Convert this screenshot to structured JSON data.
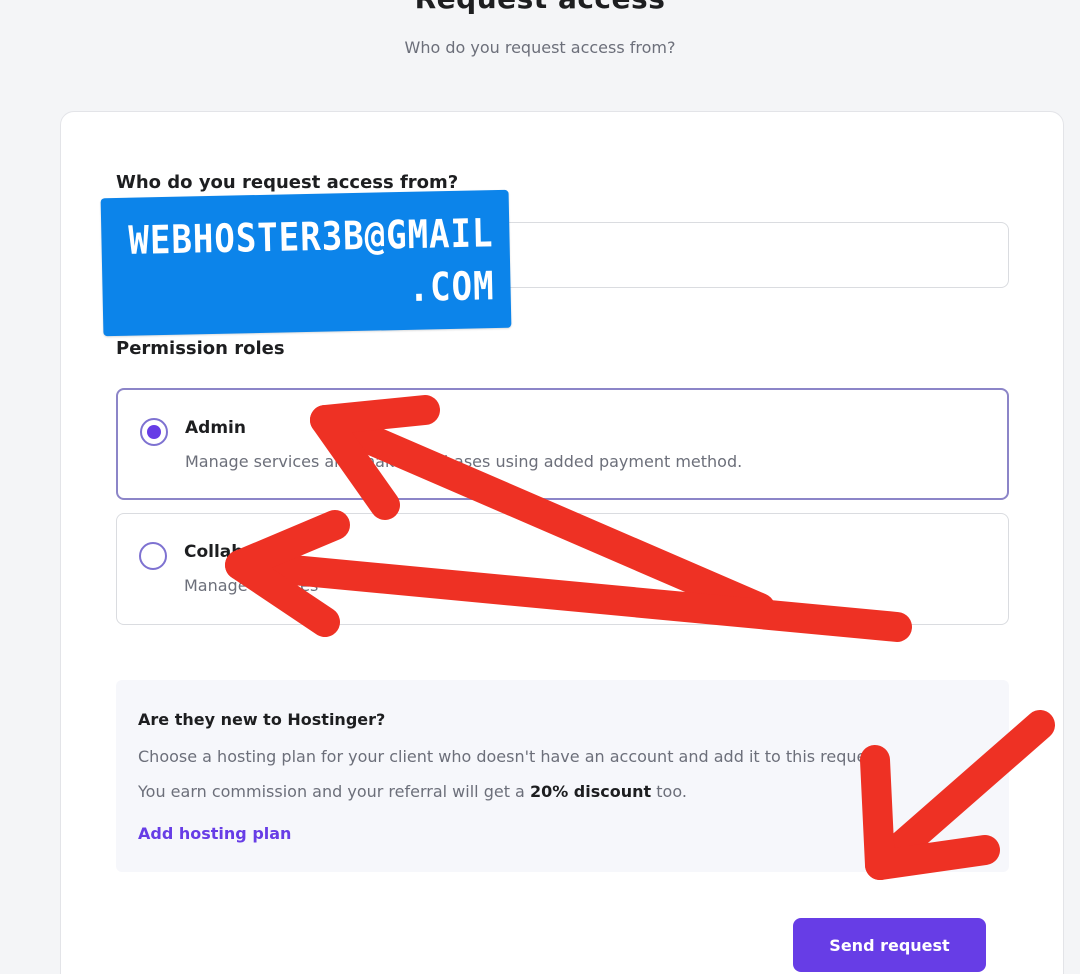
{
  "header": {
    "title": "Request access",
    "subtitle": "Who do you request access from?"
  },
  "form": {
    "email_label": "Who do you request access from?",
    "email_value": "",
    "email_overlay_line1": "WEBHOSTER3B@GMAIL",
    "email_overlay_line2": ".COM",
    "roles_label": "Permission roles",
    "roles": [
      {
        "title": "Admin",
        "description": "Manage services and make purchases using added payment method.",
        "selected": true
      },
      {
        "title": "Collaborator",
        "description": "Manage services",
        "selected": false
      }
    ]
  },
  "promo": {
    "title": "Are they new to Hostinger?",
    "line1": "Choose a hosting plan for your client who doesn't have an account and add it to this request.",
    "line2_prefix": "You earn commission and your referral will get a ",
    "line2_bold": "20% discount",
    "line2_suffix": " too.",
    "link_label": "Add hosting plan"
  },
  "actions": {
    "send_label": "Send request"
  },
  "colors": {
    "accent": "#673de6",
    "annotation_red": "#ee3124",
    "sticker_blue": "#0c84ea"
  }
}
